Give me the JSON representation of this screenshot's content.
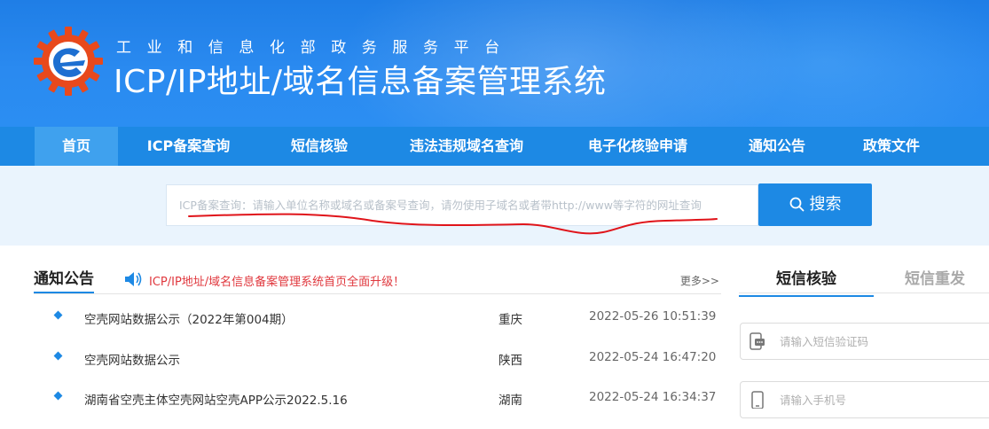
{
  "header": {
    "subtitle": "工业和信息化部政务服务平台",
    "title": "ICP/IP地址/域名信息备案管理系统",
    "logo_icon": "miit-gear-logo-icon"
  },
  "colors": {
    "brand_blue": "#1d89e4",
    "nav_active": "#3fa1ee",
    "alert_red": "#e0383e",
    "annotation_red": "#e0141a"
  },
  "nav": {
    "items": [
      {
        "label": "首页",
        "active": true
      },
      {
        "label": "ICP备案查询",
        "active": false
      },
      {
        "label": "短信核验",
        "active": false
      },
      {
        "label": "违法违规域名查询",
        "active": false
      },
      {
        "label": "电子化核验申请",
        "active": false
      },
      {
        "label": "通知公告",
        "active": false
      },
      {
        "label": "政策文件",
        "active": false
      }
    ]
  },
  "search": {
    "placeholder": "ICP备案查询：请输入单位名称或域名或备案号查询，请勿使用子域名或者带http://www等字符的网址查询",
    "button_label": "搜索",
    "button_icon": "search-icon"
  },
  "notices": {
    "title": "通知公告",
    "marquee": "ICP/IP地址/域名信息备案管理系统首页全面升级！",
    "more_label": "更多>>",
    "rows": [
      {
        "title": "空壳网站数据公示（2022年第004期）",
        "region": "重庆",
        "time": "2022-05-26 10:51:39"
      },
      {
        "title": "空壳网站数据公示",
        "region": "陕西",
        "time": "2022-05-24 16:47:20"
      },
      {
        "title": "湖南省空壳主体空壳网站空壳APP公示2022.5.16",
        "region": "湖南",
        "time": "2022-05-24 16:34:37"
      }
    ]
  },
  "sms": {
    "tabs": [
      {
        "label": "短信核验",
        "active": true
      },
      {
        "label": "短信重发",
        "active": false
      }
    ],
    "code_placeholder": "请输入短信验证码",
    "phone_placeholder": "请输入手机号"
  }
}
